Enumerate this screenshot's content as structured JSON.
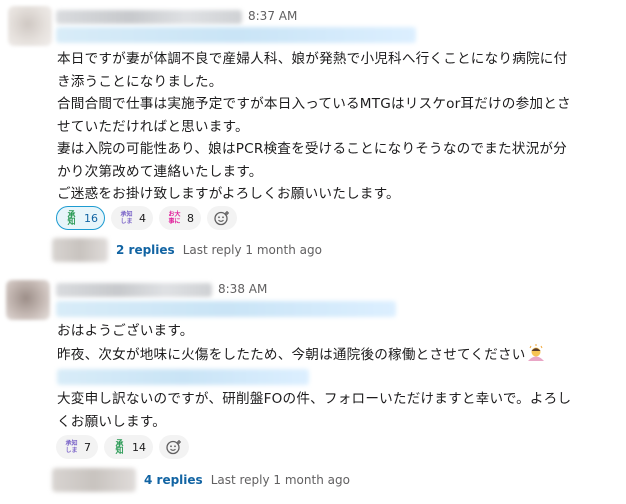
{
  "messages": [
    {
      "time": "8:37 AM",
      "lines": [
        "本日ですが妻が体調不良で産婦人科、娘が発熱で小児科へ行くことになり病院に付",
        "き添うことになりました。",
        "合間合間で仕事は実施予定ですが本日入っているMTGはリスケor耳だけの参加とさ",
        "せていただければと思います。",
        "妻は入院の可能性あり、娘はPCR検査を受けることになりそうなのでまた状況が分",
        "かり次第改めて連絡いたします。",
        "ご迷惑をお掛け致しますがよろしくお願いいたします。"
      ],
      "reactions": [
        {
          "icon": "shouchi-icon",
          "label": "承知",
          "count": "16"
        },
        {
          "icon": "shouchi-shimashita-icon",
          "label": "承知しました",
          "count": "4"
        },
        {
          "icon": "odaiji-ni-icon",
          "label": "お大事に",
          "count": "8"
        }
      ],
      "thread": {
        "replies": "2 replies",
        "last": "Last reply 1 month ago"
      }
    },
    {
      "time": "8:38 AM",
      "lines_a": [
        "おはようございます。",
        "昨夜、次女が地味に火傷をしたため、今朝は通院後の稼働とさせてください"
      ],
      "lines_b": [
        "大変申し訳ないのですが、研削盤FOの件、フォローいただけますと幸いで。よろし",
        "くお願いします。"
      ],
      "reactions": [
        {
          "icon": "shouchi-shimashita-icon",
          "label": "承知しました",
          "count": "7"
        },
        {
          "icon": "shouchi-icon",
          "label": "承知",
          "count": "14"
        }
      ],
      "thread": {
        "replies": "4 replies",
        "last": "Last reply 1 month ago"
      }
    }
  ],
  "colors": {
    "link": "#1264a3",
    "active_reaction_border": "#1d9bd1"
  }
}
